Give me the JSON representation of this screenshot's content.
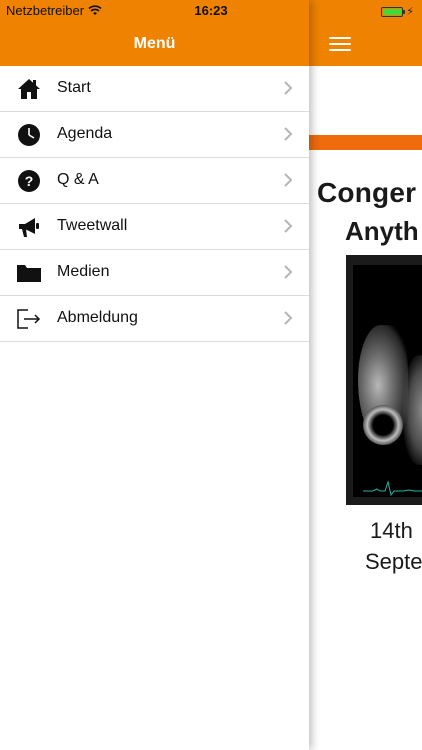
{
  "status_bar": {
    "carrier": "Netzbetreiber",
    "time": "16:23",
    "battery_color": "#3ddb3d"
  },
  "drawer": {
    "title": "Menü",
    "header_color": "#ef8200",
    "items": [
      {
        "label": "Start",
        "icon": "home-icon"
      },
      {
        "label": "Agenda",
        "icon": "clock-icon"
      },
      {
        "label": "Q & A",
        "icon": "question-icon"
      },
      {
        "label": "Tweetwall",
        "icon": "megaphone-icon"
      },
      {
        "label": "Medien",
        "icon": "folder-icon"
      },
      {
        "label": "Abmeldung",
        "icon": "logout-icon"
      }
    ]
  },
  "main": {
    "title_partial": "Conger",
    "subtitle_partial": "Anyth",
    "date_line1": "14th",
    "date_line2": "Septe",
    "accent_color": "#ef6b0c"
  }
}
